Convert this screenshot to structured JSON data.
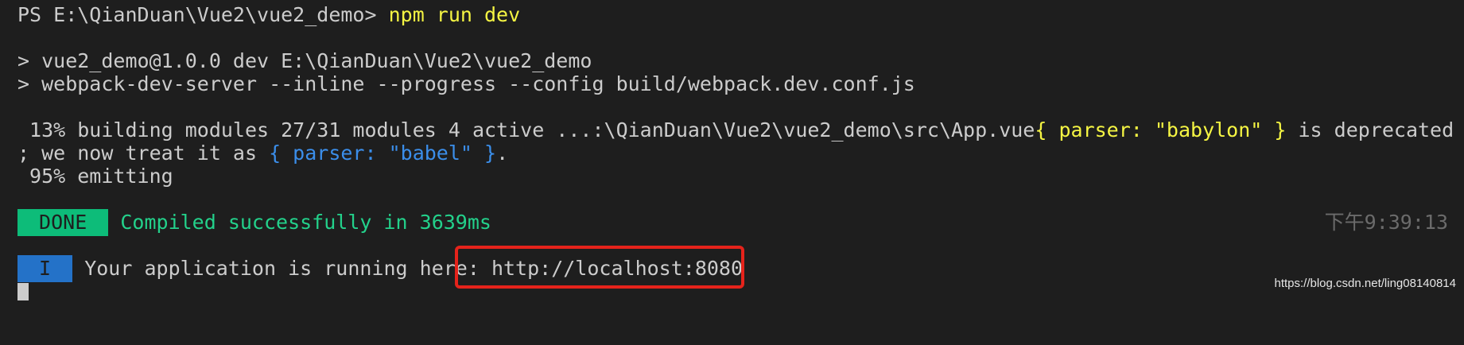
{
  "terminal": {
    "top_clip": "                    ",
    "prompt": "PS E:\\QianDuan\\Vue2\\vue2_demo> ",
    "command": "npm run dev",
    "script_name_line": "> vue2_demo@1.0.0 dev E:\\QianDuan\\Vue2\\vue2_demo",
    "script_cmd_line": "> webpack-dev-server --inline --progress --config build/webpack.dev.conf.js",
    "progress_line_prefix": " 13% building modules 27/31 modules 4 active ...:\\QianDuan\\Vue2\\vue2_demo\\src\\App.vue",
    "progress_line_yellow": "{ parser: \"babylon\" }",
    "progress_line_suffix": " is deprecated",
    "deprecation_prefix": "; we now treat it as ",
    "deprecation_blue": "{ parser: \"babel\" }",
    "deprecation_suffix": ".",
    "emitting_line": " 95% emitting",
    "done_badge": " DONE ",
    "compiled_message": " Compiled successfully in 3639ms",
    "timestamp": "下午9:39:13",
    "info_badge": " I ",
    "running_message": " Your application is running here: ",
    "url": "http://localhost:8080"
  },
  "watermark": "https://blog.csdn.net/ling08140814",
  "colors": {
    "background": "#1e1e1e",
    "foreground": "#cccccc",
    "yellow": "#f5f543",
    "blue": "#3b8eea",
    "green": "#23d18b",
    "done_badge_bg": "#0dbc79",
    "info_badge_bg": "#2472c8",
    "highlight_box": "#e5231b"
  }
}
